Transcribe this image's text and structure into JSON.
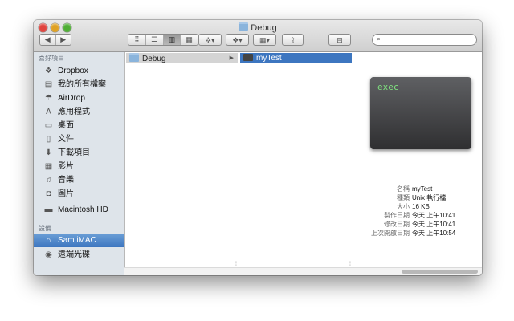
{
  "window": {
    "title": "Debug"
  },
  "toolbar": {
    "back_glyph": "◀",
    "forward_glyph": "▶",
    "view_buttons": [
      "⠿",
      "☰",
      "▥",
      "▦"
    ],
    "action_glyph": "✲▾",
    "dropbox_glyph": "❖▾",
    "arrange_glyph": "▦▾",
    "share_glyph": "⇪",
    "drive_glyph": "⊟",
    "search_icon": "🔍",
    "search_placeholder": ""
  },
  "sidebar": {
    "favorites_header": "喜好項目",
    "favorites": [
      {
        "icon": "dropbox-icon",
        "glyph": "❖",
        "label": "Dropbox"
      },
      {
        "icon": "all-files-icon",
        "glyph": "▤",
        "label": "我的所有檔案"
      },
      {
        "icon": "airdrop-icon",
        "glyph": "☂",
        "label": "AirDrop"
      },
      {
        "icon": "applications-icon",
        "glyph": "A",
        "label": "應用程式"
      },
      {
        "icon": "desktop-icon",
        "glyph": "▭",
        "label": "桌面"
      },
      {
        "icon": "documents-icon",
        "glyph": "▯",
        "label": "文件"
      },
      {
        "icon": "downloads-icon",
        "glyph": "⬇",
        "label": "下載項目"
      },
      {
        "icon": "movies-icon",
        "glyph": "▦",
        "label": "影片"
      },
      {
        "icon": "music-icon",
        "glyph": "♫",
        "label": "音樂"
      },
      {
        "icon": "pictures-icon",
        "glyph": "◘",
        "label": "圖片"
      },
      {
        "icon": "harddrive-icon",
        "glyph": "▬",
        "label": "Macintosh HD"
      }
    ],
    "devices_header": "設備",
    "devices": [
      {
        "icon": "computer-icon",
        "glyph": "⌂",
        "label": "Sam iMAC",
        "selected": true
      },
      {
        "icon": "remote-disc-icon",
        "glyph": "◉",
        "label": "遠端光碟"
      }
    ]
  },
  "columns": {
    "col1": {
      "label": "Debug",
      "icon": "folder-icon"
    },
    "col2": {
      "label": "myTest",
      "icon": "exec-icon"
    }
  },
  "preview": {
    "exec_label": "exec",
    "info": [
      {
        "key": "名稱",
        "value": "myTest"
      },
      {
        "key": "種類",
        "value": "Unix 執行檔"
      },
      {
        "key": "大小",
        "value": "16 KB"
      },
      {
        "key": "製作日期",
        "value": "今天 上午10:41"
      },
      {
        "key": "修改日期",
        "value": "今天 上午10:41"
      },
      {
        "key": "上次開啟日期",
        "value": "今天 上午10:54"
      }
    ]
  },
  "colors": {
    "selection": "#3d76c0",
    "sidebar_bg": "#dee4ea"
  }
}
